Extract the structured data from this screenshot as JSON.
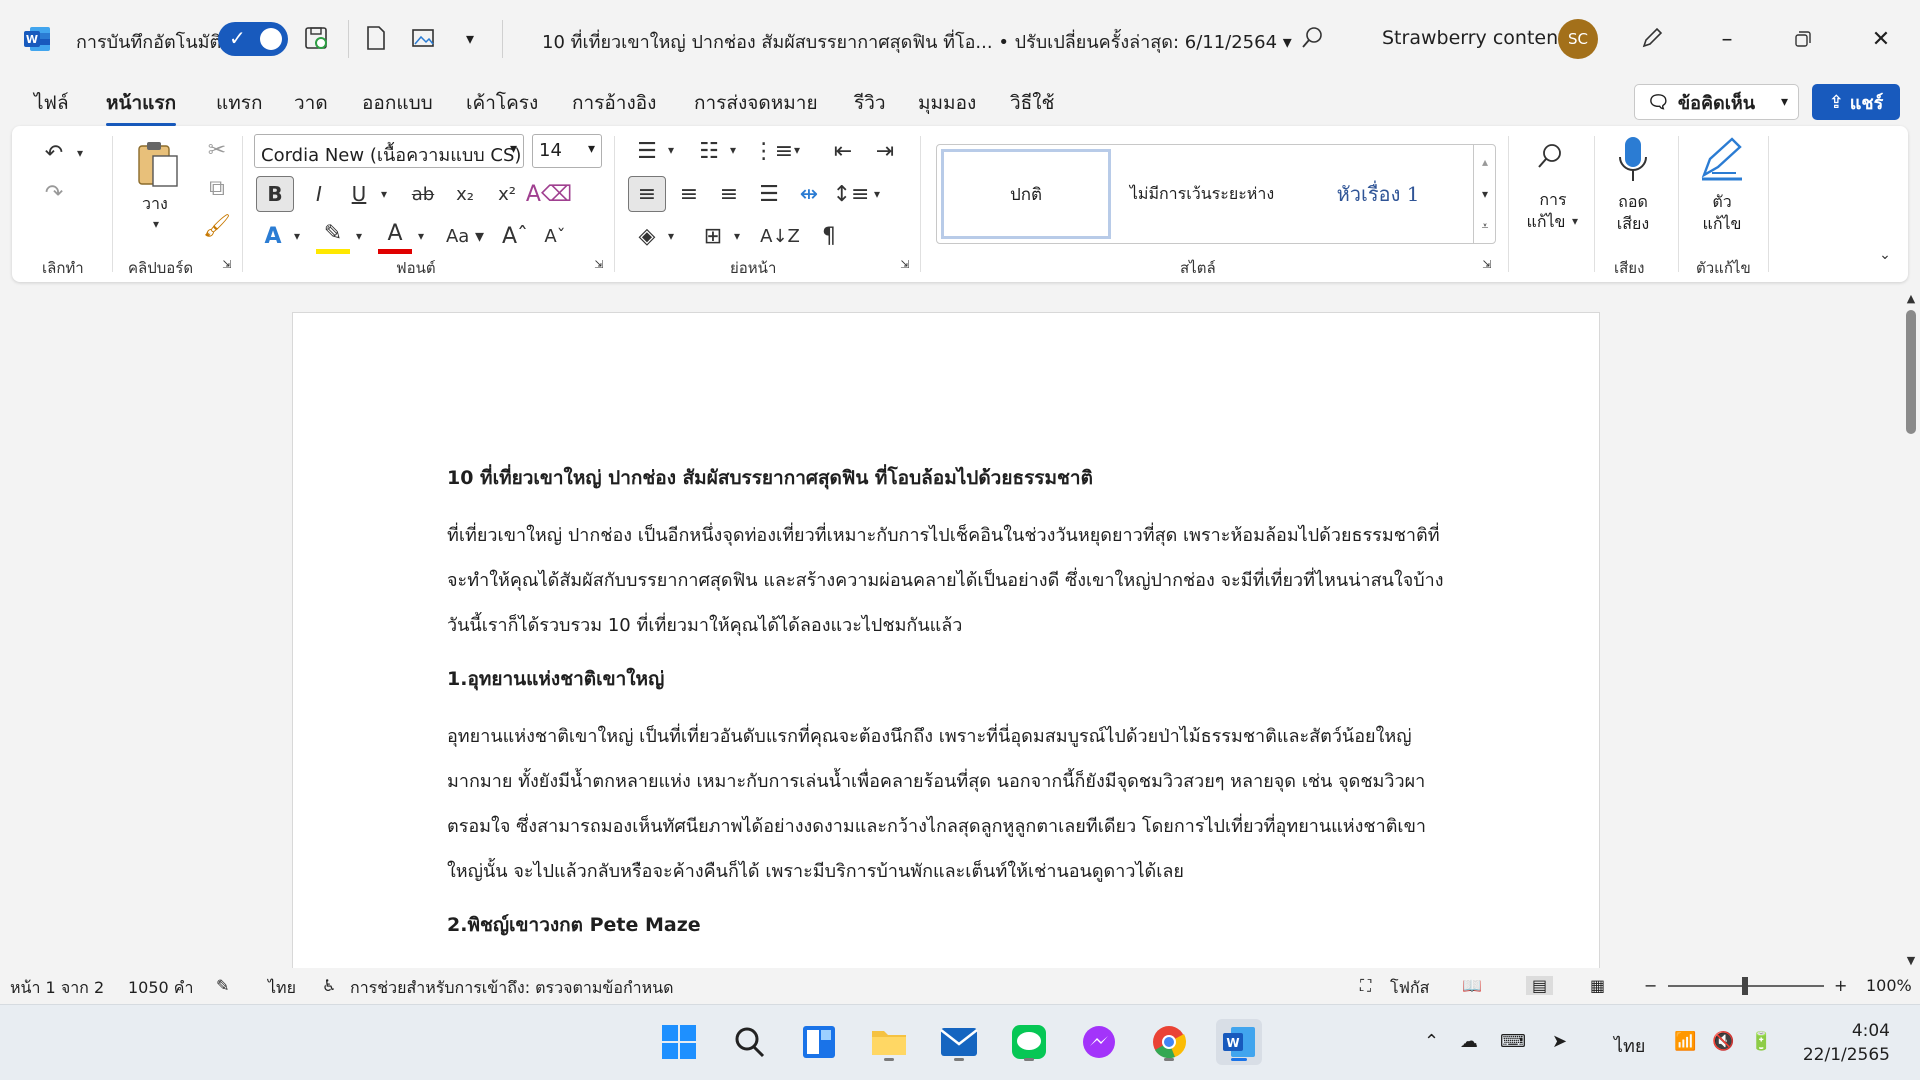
{
  "titlebar": {
    "autosave_label": "การบันทึกอัตโนมัติ",
    "doc_title": "10 ที่เที่ยวเขาใหญ่ ปากช่อง สัมผัสบรรยากาศสุดฟิน ที่โอ... • ปรับเปลี่ยนครั้งล่าสุด: 6/11/2564 ▾",
    "user_name": "Strawberry content",
    "avatar_initials": "SC",
    "brand_color": "#185abd"
  },
  "tabs": [
    "ไฟล์",
    "หน้าแรก",
    "แทรก",
    "วาด",
    "ออกแบบ",
    "เค้าโครง",
    "การอ้างอิง",
    "การส่งจดหมาย",
    "รีวิว",
    "มุมมอง",
    "วิธีใช้"
  ],
  "actions": {
    "comments": "ข้อคิดเห็น",
    "share": "แชร์"
  },
  "ribbon": {
    "paste_label": "วาง",
    "font_name": "Cordia New (เนื้อความแบบ CS)",
    "font_size": "14",
    "styles": [
      "ปกติ",
      "ไม่มีการเว้นระยะห่าง",
      "หัวเรื่อง 1"
    ],
    "editing_label_1": "การ",
    "editing_label_2": "แก้ไข",
    "dictate_label_1": "ถอด",
    "dictate_label_2": "เสียง",
    "editor_label_1": "ตัว",
    "editor_label_2": "แก้ไข",
    "groups": {
      "undo": "เลิกทำ",
      "clipboard": "คลิปบอร์ด",
      "font": "ฟอนต์",
      "paragraph": "ย่อหน้า",
      "styles": "สไตล์",
      "voice": "เสียง",
      "editor": "ตัวแก้ไข"
    }
  },
  "document": {
    "title": "10 ที่เที่ยวเขาใหญ่ ปากช่อง สัมผัสบรรยากาศสุดฟิน ที่โอบล้อมไปด้วยธรรมชาติ",
    "intro": "ที่เที่ยวเขาใหญ่ ปากช่อง เป็นอีกหนึ่งจุดท่องเที่ยวที่เหมาะกับการไปเช็คอินในช่วงวันหยุดยาวที่สุด เพราะห้อมล้อมไปด้วยธรรมชาติที่จะทำให้คุณได้สัมผัสกับบรรยากาศสุดฟิน และสร้างความผ่อนคลายได้เป็นอย่างดี ซึ่งเขาใหญ่ปากช่อง จะมีที่เที่ยวที่ไหนน่าสนใจบ้าง วันนี้เราก็ได้รวบรวม 10 ที่เที่ยวมาให้คุณได้ได้ลองแวะไปชมกันแล้ว",
    "h1": "1.อุทยานแห่งชาติเขาใหญ่",
    "p1": "อุทยานแห่งชาติเขาใหญ่ เป็นที่เที่ยวอันดับแรกที่คุณจะต้องนึกถึง เพราะที่นี่อุดมสมบูรณ์ไปด้วยป่าไม้ธรรมชาติและสัตว์น้อยใหญ่มากมาย ทั้งยังมีน้ำตกหลายแห่ง เหมาะกับการเล่นน้ำเพื่อคลายร้อนที่สุด นอกจากนี้ก็ยังมีจุดชมวิวสวยๆ หลายจุด เช่น จุดชมวิวผาตรอมใจ ซึ่งสามารถมองเห็นทัศนียภาพได้อย่างงดงามและกว้างไกลสุดลูกหูลูกตาเลยทีเดียว โดยการไปเที่ยวที่อุทยานแห่งชาติเขาใหญ่นั้น จะไปแล้วกลับหรือจะค้างคืนก็ได้ เพราะมีบริการบ้านพักและเต็นท์ให้เช่านอนดูดาวได้เลย",
    "h2": "2.พิชญ์เขาวงกต Pete Maze"
  },
  "statusbar": {
    "page": "หน้า 1 จาก 2",
    "words": "1050 คำ",
    "language": "ไทย",
    "accessibility": "การช่วยสำหรับการเข้าถึง: ตรวจตามข้อกำหนด",
    "focus": "โฟกัส",
    "zoom": "100%"
  },
  "taskbar": {
    "language": "ไทย",
    "time": "4:04",
    "date": "22/1/2565"
  }
}
